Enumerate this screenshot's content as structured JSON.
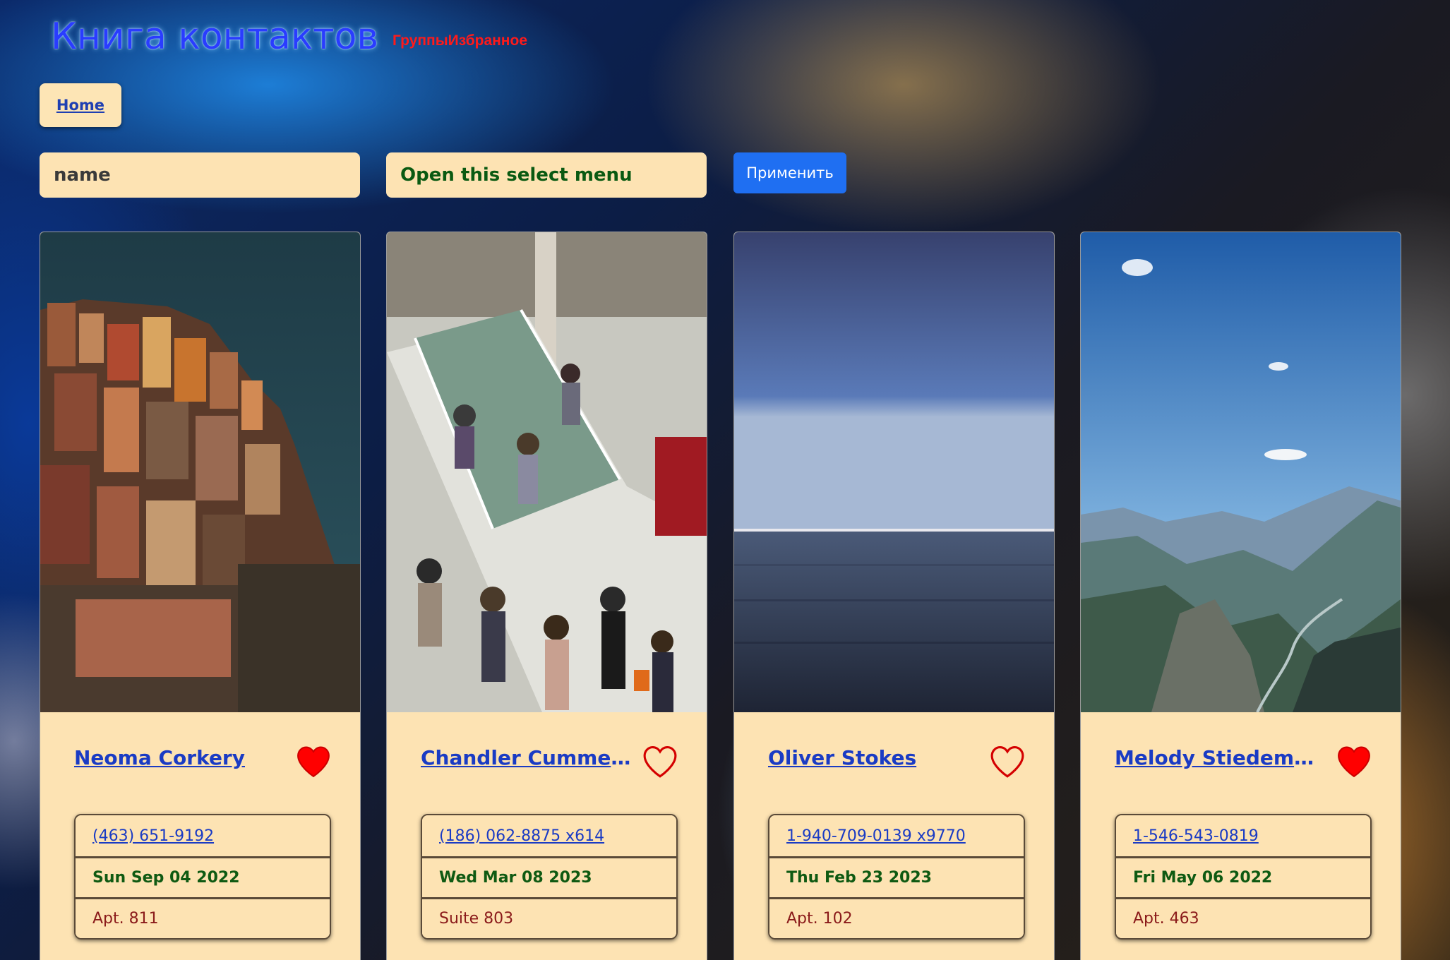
{
  "header": {
    "title": "Книга контактов",
    "nav": [
      "Группы",
      "Избранное"
    ]
  },
  "home_label": "Home",
  "filters": {
    "search_value": "name",
    "select_value": "Open this select menu",
    "apply_label": "Применить"
  },
  "colors": {
    "card_bg": "#fde3b3",
    "accent": "#1f6ff2",
    "favorite": "#ff0000"
  },
  "contacts": [
    {
      "name": "Neoma Corkery",
      "phone": "(463) 651-9192",
      "date": "Sun Sep 04 2022",
      "address": "Apt. 811",
      "favorite": true,
      "photo": "cliffside-town-photo"
    },
    {
      "name": "Chandler Cummer...",
      "phone": "(186) 062-8875 x614",
      "date": "Wed Mar 08 2023",
      "address": "Suite 803",
      "favorite": false,
      "photo": "crowded-stairs-photo"
    },
    {
      "name": "Oliver Stokes",
      "phone": "1-940-709-0139 x9770",
      "date": "Thu Feb 23 2023",
      "address": "Apt. 102",
      "favorite": false,
      "photo": "sea-horizon-photo"
    },
    {
      "name": "Melody Stiedemann",
      "phone": "1-546-543-0819",
      "date": "Fri May 06 2022",
      "address": "Apt. 463",
      "favorite": true,
      "photo": "mountain-valley-photo"
    }
  ]
}
